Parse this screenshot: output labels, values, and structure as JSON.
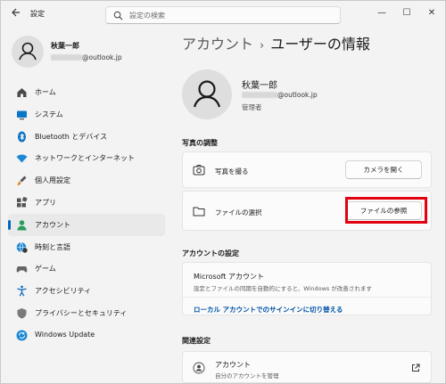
{
  "window": {
    "title": "設定",
    "controls": {
      "minimize": "—",
      "maximize": "☐",
      "close": "✕"
    }
  },
  "search": {
    "placeholder": "設定の検索"
  },
  "profile": {
    "name": "秋葉一郎",
    "email_suffix": "@outlook.jp"
  },
  "nav": {
    "items": [
      {
        "label": "ホーム",
        "icon": "home-icon"
      },
      {
        "label": "システム",
        "icon": "system-icon"
      },
      {
        "label": "Bluetooth とデバイス",
        "icon": "bluetooth-icon"
      },
      {
        "label": "ネットワークとインターネット",
        "icon": "wifi-icon"
      },
      {
        "label": "個人用設定",
        "icon": "brush-icon"
      },
      {
        "label": "アプリ",
        "icon": "apps-icon"
      },
      {
        "label": "アカウント",
        "icon": "account-icon",
        "active": true
      },
      {
        "label": "時刻と言語",
        "icon": "globe-clock-icon"
      },
      {
        "label": "ゲーム",
        "icon": "gamepad-icon"
      },
      {
        "label": "アクセシビリティ",
        "icon": "accessibility-icon"
      },
      {
        "label": "プライバシーとセキュリティ",
        "icon": "shield-icon"
      },
      {
        "label": "Windows Update",
        "icon": "update-icon"
      }
    ]
  },
  "breadcrumb": {
    "parent": "アカウント",
    "separator": "›",
    "current": "ユーザーの情報"
  },
  "user": {
    "name": "秋葉一郎",
    "email_suffix": "@outlook.jp",
    "role": "管理者"
  },
  "photo": {
    "heading": "写真の調整",
    "take_photo": {
      "label": "写真を撮る",
      "button": "カメラを開く"
    },
    "choose_file": {
      "label": "ファイルの選択",
      "button": "ファイルの参照"
    }
  },
  "account_settings": {
    "heading": "アカウントの設定",
    "title": "Microsoft アカウント",
    "description": "設定とファイルの同期を自動的にすると、Windows が改善されます",
    "link": "ローカル アカウントでのサインインに切り替える"
  },
  "related": {
    "heading": "関連設定",
    "item": {
      "title": "アカウント",
      "subtitle": "自分のアカウントを管理"
    }
  },
  "colors": {
    "accent": "#0067c0",
    "highlight": "#e3000f",
    "link": "#0055a8"
  }
}
